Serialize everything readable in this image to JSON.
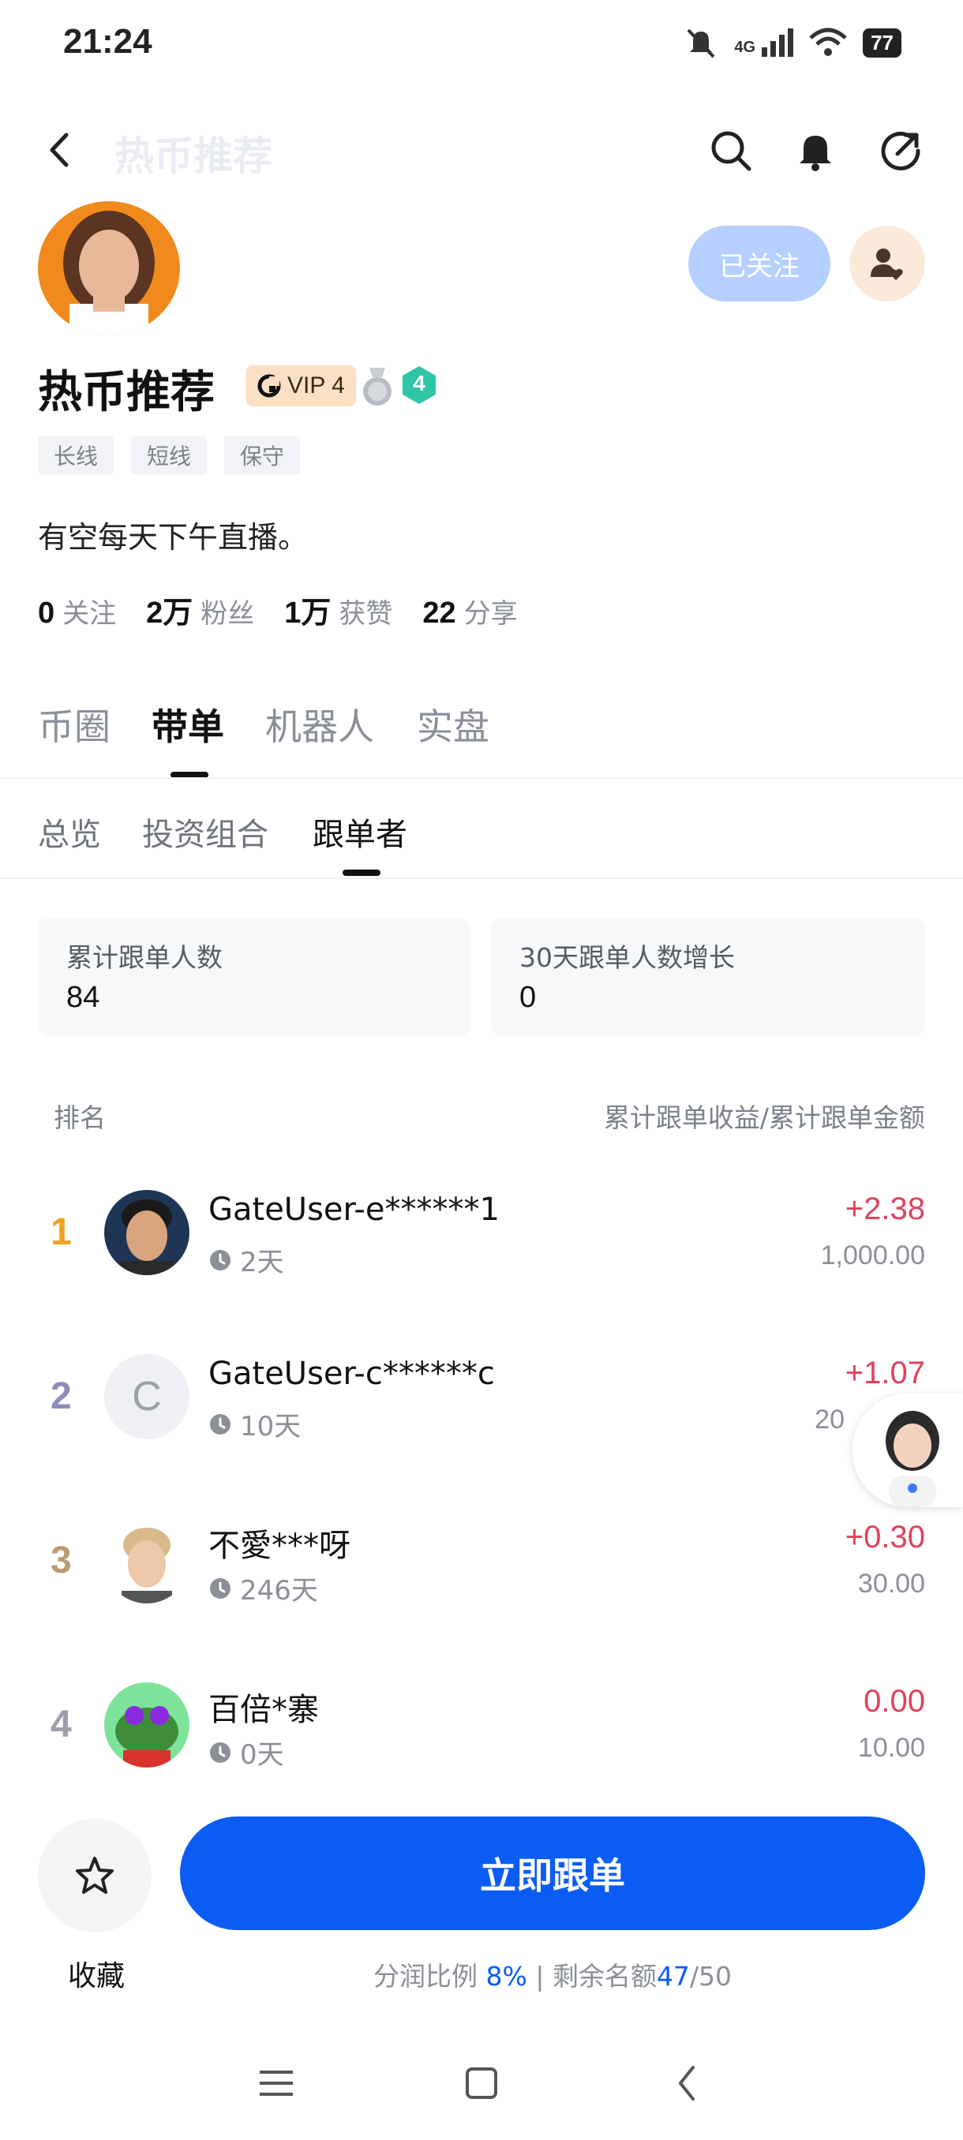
{
  "status_bar": {
    "time": "21:24",
    "network": "4G",
    "battery": "77"
  },
  "nav": {
    "title": "热币推荐"
  },
  "profile": {
    "name": "热币推荐",
    "vip": "VIP 4",
    "level": "4",
    "follow_label": "已关注",
    "tags": [
      "长线",
      "短线",
      "保守"
    ],
    "bio": "有空每天下午直播。",
    "stats": [
      {
        "num": "0",
        "label": "关注"
      },
      {
        "num": "2万",
        "label": "粉丝"
      },
      {
        "num": "1万",
        "label": "获赞"
      },
      {
        "num": "22",
        "label": "分享"
      }
    ]
  },
  "main_tabs": [
    "币圈",
    "带单",
    "机器人",
    "实盘"
  ],
  "sub_tabs": [
    "总览",
    "投资组合",
    "跟单者"
  ],
  "cards": [
    {
      "label": "累计跟单人数",
      "value": "84"
    },
    {
      "label": "30天跟单人数增长",
      "value": "0"
    }
  ],
  "list_header": {
    "left": "排名",
    "right": "累计跟单收益/累计跟单金额"
  },
  "rows": [
    {
      "rank": "1",
      "name": "GateUser-e******1",
      "days": "2天",
      "profit": "+2.38",
      "amount": "1,000.00",
      "rank_color": "#f0a21d"
    },
    {
      "rank": "2",
      "name": "GateUser-c******c",
      "days": "10天",
      "profit": "+1.07",
      "amount": "20",
      "rank_color": "#8e8cb8",
      "avatar_letter": "C"
    },
    {
      "rank": "3",
      "name": "不愛***呀",
      "days": "246天",
      "profit": "+0.30",
      "amount": "30.00",
      "rank_color": "#b99a6f"
    },
    {
      "rank": "4",
      "name": "百倍*寨",
      "days": "0天",
      "profit": "0.00",
      "amount": "10.00",
      "rank_color": "#9a9fa8"
    }
  ],
  "bottom": {
    "fav_label": "收藏",
    "cta_label": "立即跟单",
    "share_ratio_label": "分润比例",
    "share_ratio": "8%",
    "sep": "|",
    "remaining_label": "剩余名额",
    "remaining": "47",
    "remaining_total": "/50"
  }
}
